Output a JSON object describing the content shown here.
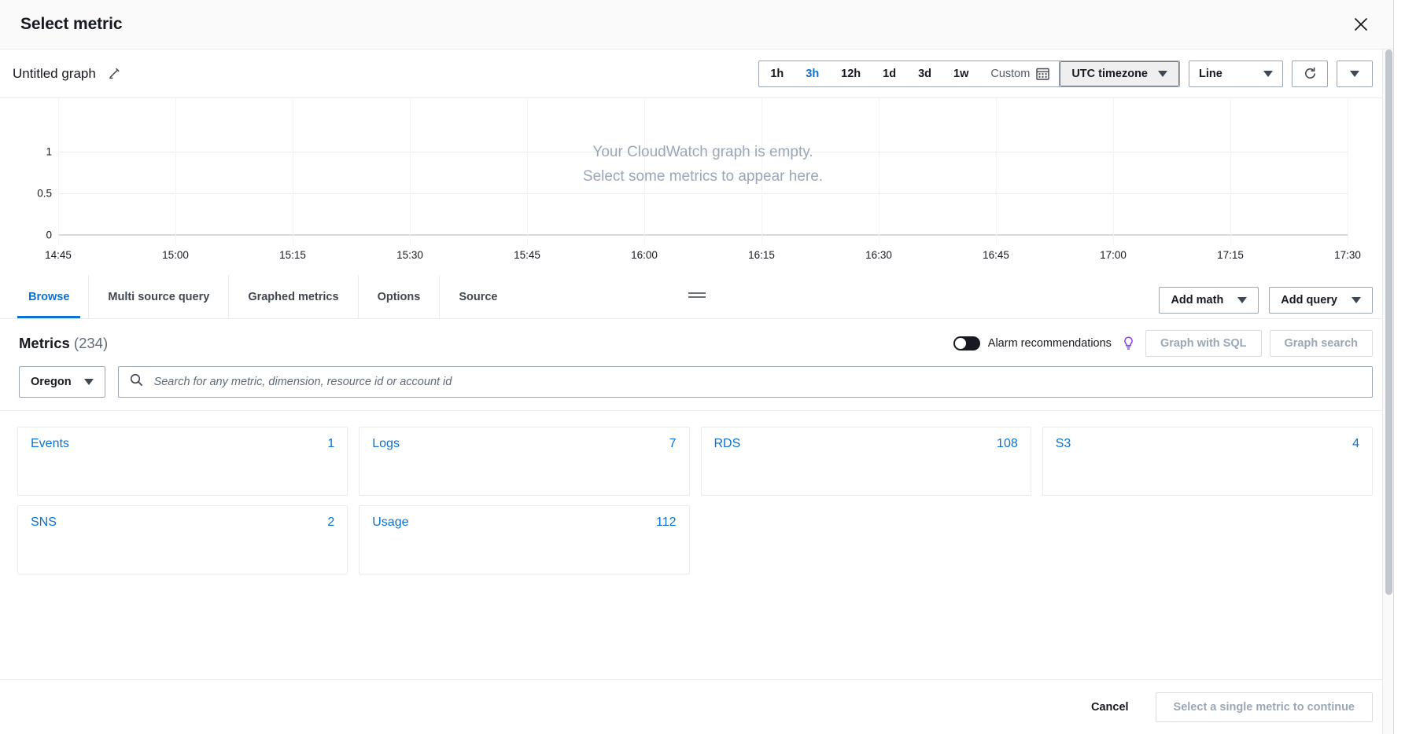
{
  "header": {
    "title": "Select metric",
    "close_icon": "close-icon"
  },
  "graph_toolbar": {
    "graph_name": "Untitled graph",
    "edit_icon": "pencil-icon",
    "time_ranges": [
      {
        "label": "1h",
        "active": false
      },
      {
        "label": "3h",
        "active": true
      },
      {
        "label": "12h",
        "active": false
      },
      {
        "label": "1d",
        "active": false
      },
      {
        "label": "3d",
        "active": false
      },
      {
        "label": "1w",
        "active": false
      }
    ],
    "custom_label": "Custom",
    "calendar_icon": "calendar-icon",
    "timezone": "UTC timezone",
    "chart_type": "Line",
    "refresh_icon": "refresh-icon",
    "refresh_options_icon": "chevron-down-icon",
    "accent_color": "#0972d3"
  },
  "chart_data": {
    "type": "line",
    "title": "Untitled graph",
    "series": [],
    "empty_message_line1": "Your CloudWatch graph is empty.",
    "empty_message_line2": "Select some metrics to appear here.",
    "x": [
      "14:45",
      "15:00",
      "15:15",
      "15:30",
      "15:45",
      "16:00",
      "16:15",
      "16:30",
      "16:45",
      "17:00",
      "17:15",
      "17:30"
    ],
    "xlabel": "",
    "ylabel": "",
    "yticks": [
      "1",
      "0.5",
      "0"
    ],
    "ylim": [
      0,
      1
    ],
    "grid": true,
    "legend": "none"
  },
  "tabs": [
    {
      "label": "Browse",
      "active": true
    },
    {
      "label": "Multi source query",
      "active": false
    },
    {
      "label": "Graphed metrics",
      "active": false
    },
    {
      "label": "Options",
      "active": false
    },
    {
      "label": "Source",
      "active": false
    }
  ],
  "tab_actions": {
    "add_math": "Add math",
    "add_query": "Add query"
  },
  "metrics": {
    "title": "Metrics",
    "count": "(234)",
    "alarm_toggle_label": "Alarm recommendations",
    "alarm_toggle_state": "off",
    "info_icon": "info-bulb-icon",
    "graph_with_sql": "Graph with SQL",
    "graph_search": "Graph search",
    "info_icon_color": "#8a3ffc"
  },
  "search": {
    "region": "Oregon",
    "search_icon": "search-icon",
    "placeholder": "Search for any metric, dimension, resource id or account id",
    "value": ""
  },
  "namespaces": [
    {
      "name": "Events",
      "count": "1"
    },
    {
      "name": "Logs",
      "count": "7"
    },
    {
      "name": "RDS",
      "count": "108"
    },
    {
      "name": "S3",
      "count": "4"
    },
    {
      "name": "SNS",
      "count": "2"
    },
    {
      "name": "Usage",
      "count": "112"
    }
  ],
  "footer": {
    "cancel": "Cancel",
    "continue": "Select a single metric to continue"
  }
}
